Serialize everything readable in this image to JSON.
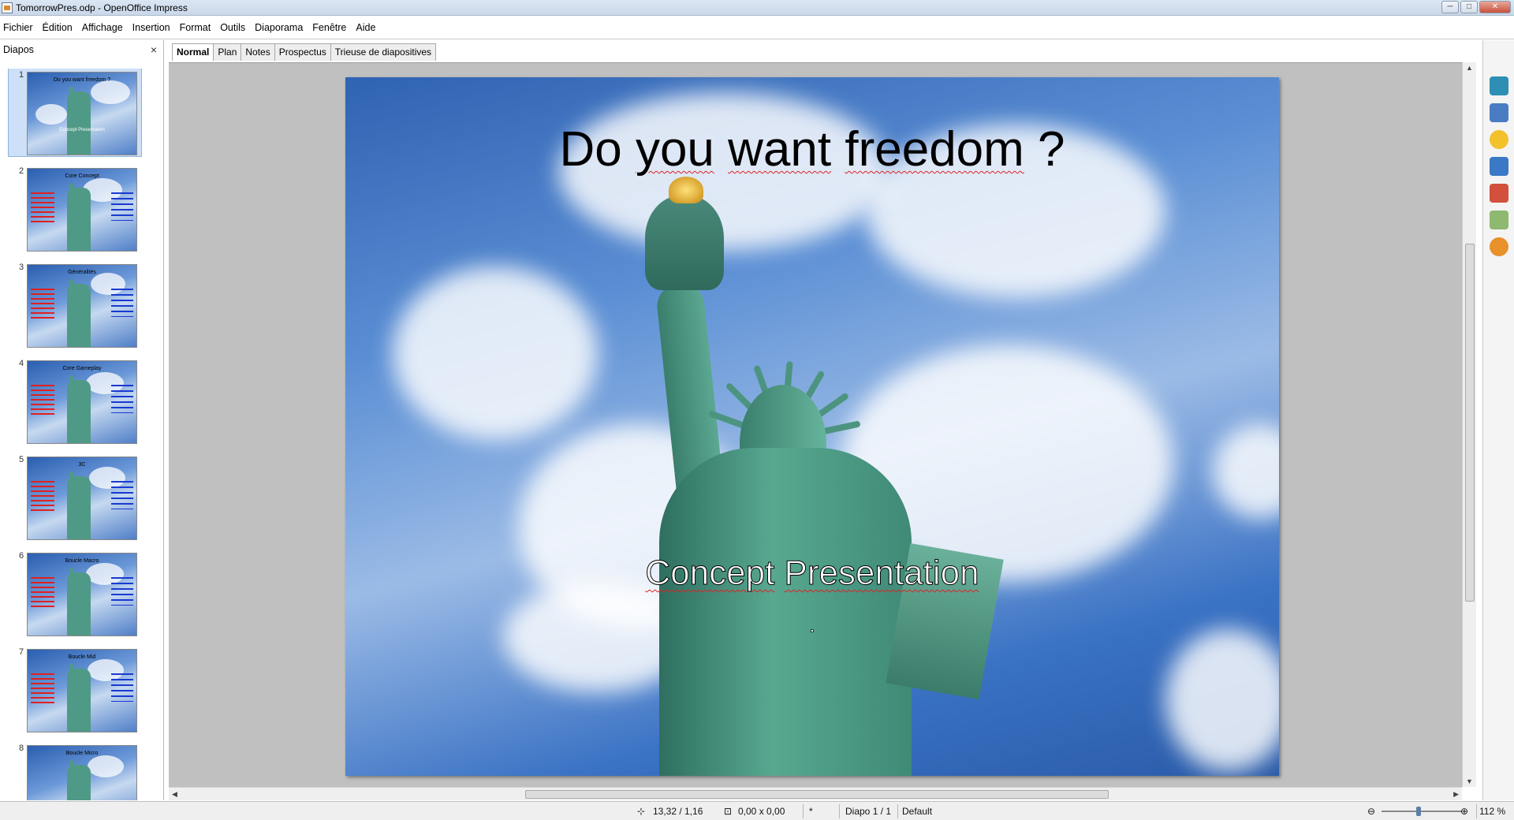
{
  "window": {
    "title": "TomorrowPres.odp - OpenOffice Impress",
    "controls": {
      "minimize": "─",
      "maximize": "□",
      "close": "✕"
    }
  },
  "menu": [
    "Fichier",
    "Édition",
    "Affichage",
    "Insertion",
    "Format",
    "Outils",
    "Diaporama",
    "Fenêtre",
    "Aide"
  ],
  "slides_pane": {
    "title": "Diapos",
    "close": "×",
    "thumbnails": [
      {
        "num": "1",
        "title": "Do you want freedom ?",
        "sub": "Concept Presentation"
      },
      {
        "num": "2",
        "title": "Core Concept",
        "sub": ""
      },
      {
        "num": "3",
        "title": "Généralités",
        "sub": ""
      },
      {
        "num": "4",
        "title": "Core Gameplay",
        "sub": ""
      },
      {
        "num": "5",
        "title": "3C",
        "sub": ""
      },
      {
        "num": "6",
        "title": "Boucle Macro",
        "sub": ""
      },
      {
        "num": "7",
        "title": "Boucle Mid",
        "sub": ""
      },
      {
        "num": "8",
        "title": "Boucle Micro",
        "sub": ""
      }
    ]
  },
  "view_tabs": [
    "Normal",
    "Plan",
    "Notes",
    "Prospectus",
    "Trieuse de diapositives"
  ],
  "active_tab": "Normal",
  "slide": {
    "title_part1": "Do ",
    "title_word1": "you",
    "title_part2": " ",
    "title_word2": "want",
    "title_part3": " ",
    "title_word3": "freedom",
    "title_part4": " ?",
    "subtitle_word1": "Concept",
    "subtitle_part": " ",
    "subtitle_word2": "Presentation"
  },
  "statusbar": {
    "position": "13,32 / 1,16",
    "size": "0,00 x 0,00",
    "modified": "*",
    "slide_indicator": "Diapo 1 / 1",
    "layout": "Default",
    "zoom": "112 %"
  },
  "colors": {
    "sky": "#2f63b3",
    "statue": "#58a890",
    "spellcheck": "#e02020",
    "zoom_knob": "#5e7ea8"
  },
  "icons": [
    "presentation-icon",
    "minimize-icon",
    "maximize-icon",
    "close-icon",
    "pane-close-icon",
    "scroll-up-icon",
    "scroll-down-icon",
    "scroll-left-icon",
    "scroll-right-icon",
    "properties-icon",
    "master-pages-icon",
    "custom-animation-icon",
    "slide-transition-icon",
    "styles-icon",
    "gallery-icon",
    "navigator-icon",
    "zoom-out-icon",
    "zoom-in-icon",
    "position-icon",
    "size-icon"
  ]
}
